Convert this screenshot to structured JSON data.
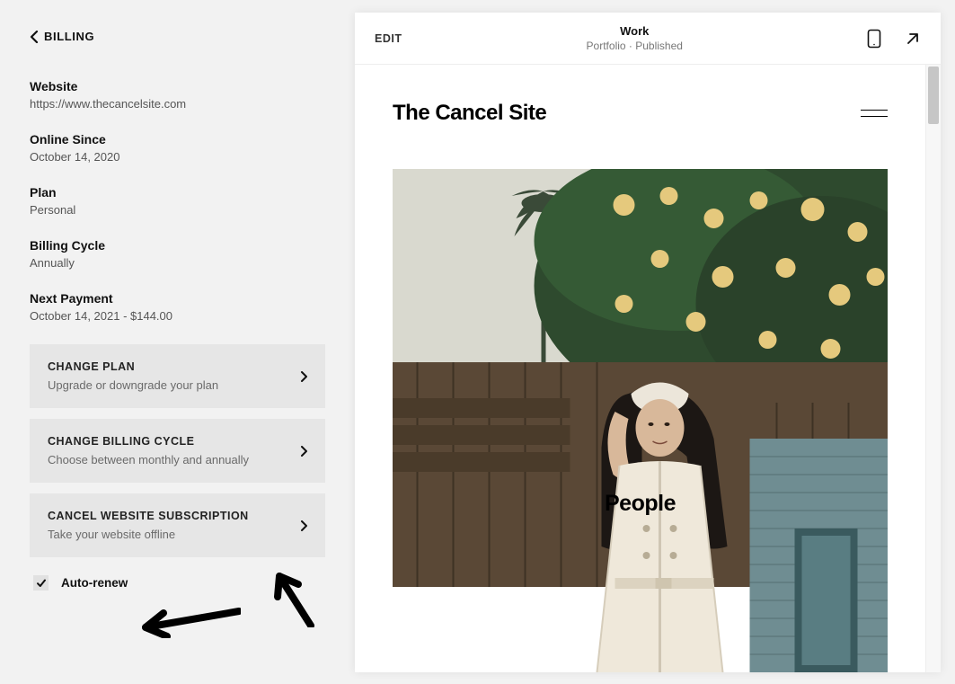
{
  "sidebar": {
    "back_label": "BILLING",
    "fields": {
      "website": {
        "label": "Website",
        "value": "https://www.thecancelsite.com"
      },
      "online": {
        "label": "Online Since",
        "value": "October 14, 2020"
      },
      "plan": {
        "label": "Plan",
        "value": "Personal"
      },
      "cycle": {
        "label": "Billing Cycle",
        "value": "Annually"
      },
      "next": {
        "label": "Next Payment",
        "value": "October 14, 2021 - $144.00"
      }
    },
    "actions": {
      "change_plan": {
        "title": "CHANGE PLAN",
        "sub": "Upgrade or downgrade your plan"
      },
      "change_cycle": {
        "title": "CHANGE BILLING CYCLE",
        "sub": "Choose between monthly and annually"
      },
      "cancel": {
        "title": "CANCEL WEBSITE SUBSCRIPTION",
        "sub": "Take your website offline"
      }
    },
    "auto_renew_label": "Auto-renew",
    "auto_renew_checked": true
  },
  "preview": {
    "edit_label": "EDIT",
    "page_name": "Work",
    "page_meta": "Portfolio · Published",
    "site_title": "The Cancel Site",
    "hero_label": "People"
  }
}
